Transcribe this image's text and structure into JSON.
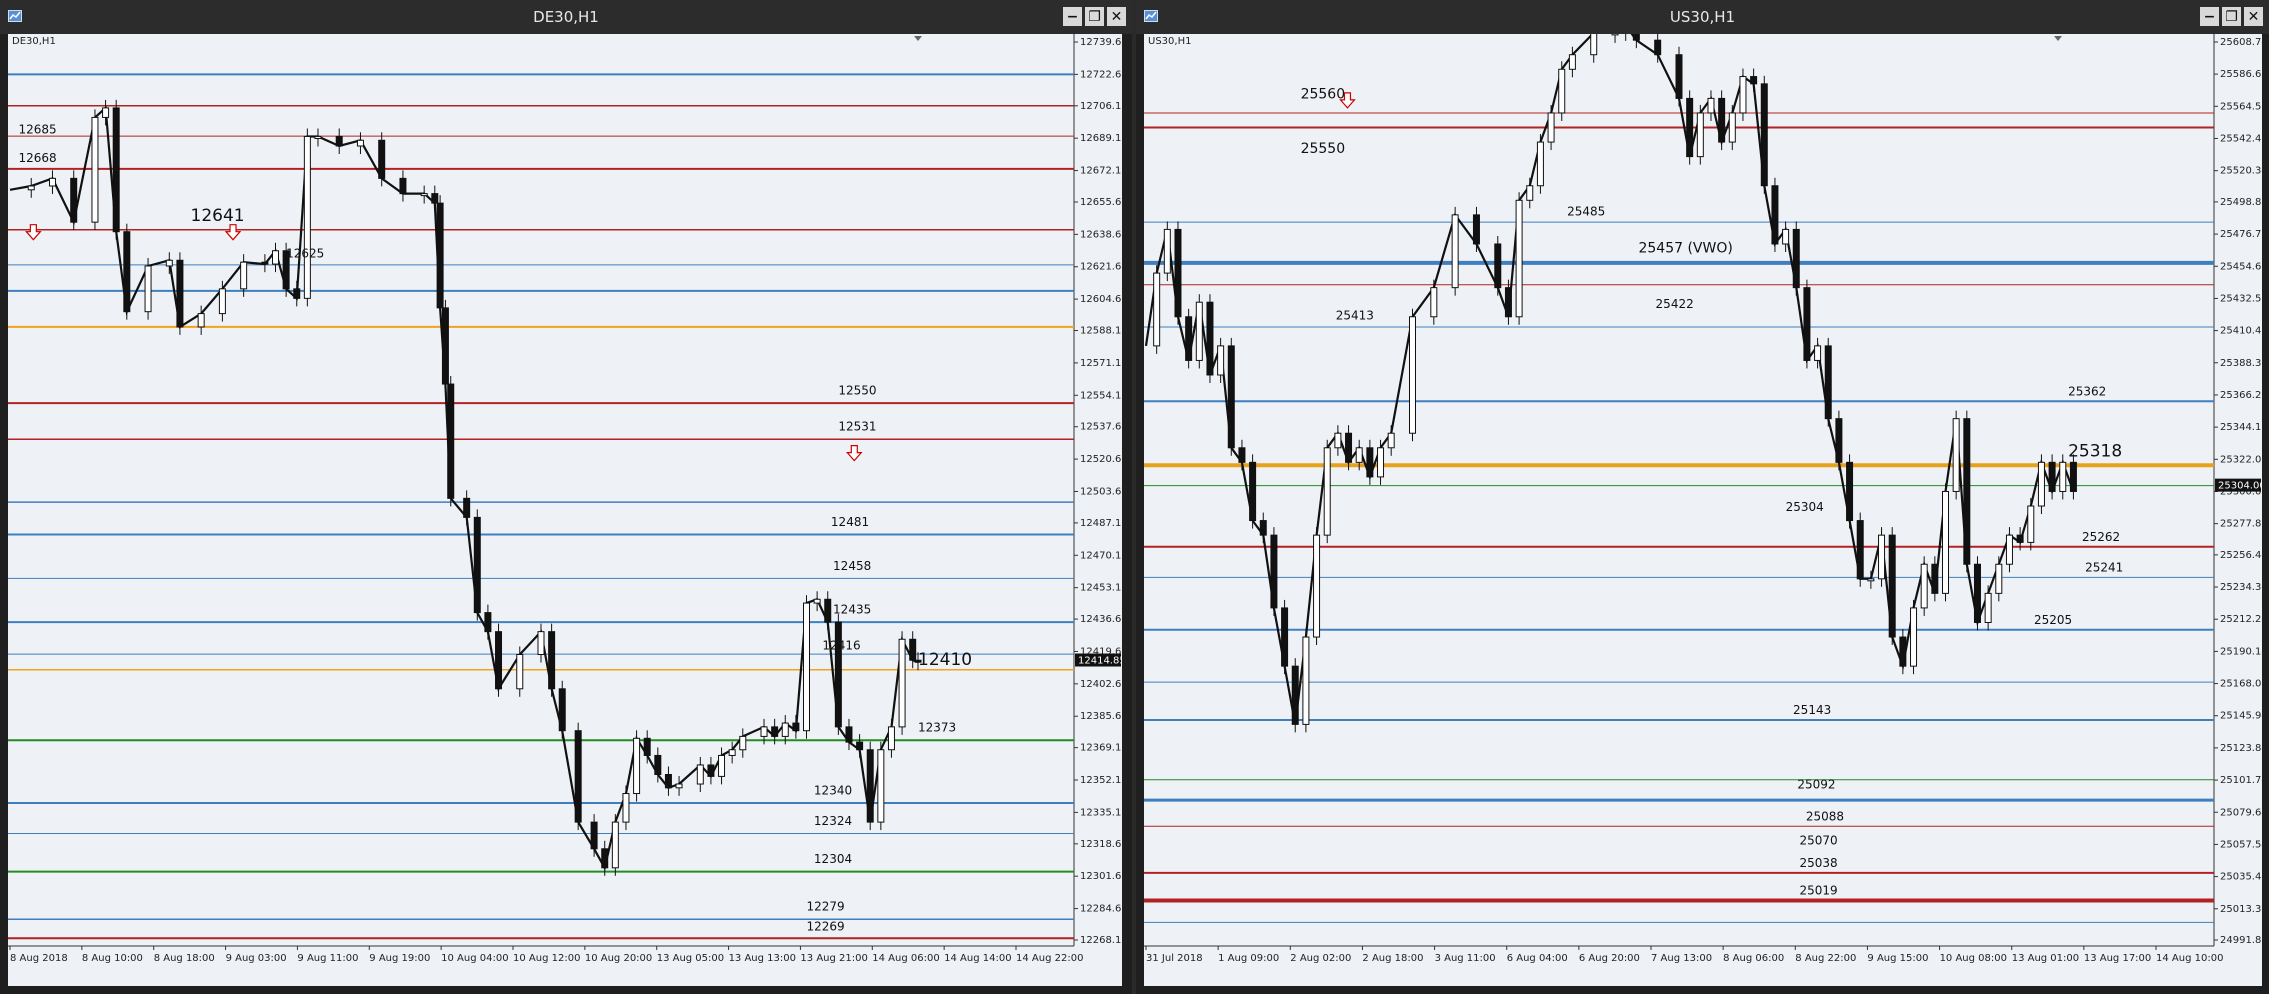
{
  "windows": [
    {
      "id": "de30",
      "title": "DE30,H1",
      "symbol_label": "DE30,H1",
      "current_price": "12414.85",
      "y_range": [
        12268.1,
        12739.6
      ],
      "price_ticks": [
        "12739.60",
        "12722.60",
        "12706.10",
        "12689.10",
        "12672.10",
        "12655.60",
        "12638.60",
        "12621.60",
        "12604.60",
        "12588.10",
        "12571.10",
        "12554.10",
        "12537.60",
        "12520.60",
        "12503.60",
        "12487.10",
        "12470.10",
        "12453.10",
        "12436.60",
        "12419.60",
        "12402.60",
        "12385.60",
        "12369.10",
        "12352.10",
        "12335.10",
        "12318.60",
        "12301.60",
        "12284.60",
        "12268.10"
      ],
      "time_labels": [
        "8 Aug 2018",
        "8 Aug 10:00",
        "8 Aug 18:00",
        "9 Aug 03:00",
        "9 Aug 11:00",
        "9 Aug 19:00",
        "10 Aug 04:00",
        "10 Aug 12:00",
        "10 Aug 20:00",
        "13 Aug 05:00",
        "13 Aug 13:00",
        "13 Aug 21:00",
        "14 Aug 06:00",
        "14 Aug 14:00",
        "14 Aug 22:00"
      ],
      "levels": [
        {
          "price": 12722.6,
          "color": "#3f7fbf",
          "width": 2
        },
        {
          "price": 12706.1,
          "color": "#b22222",
          "width": 1.5
        },
        {
          "price": 12690.2,
          "color": "#b22222",
          "width": 1
        },
        {
          "price": 12673.0,
          "color": "#b22222",
          "width": 2
        },
        {
          "price": 12641.0,
          "color": "#b22222",
          "width": 1.5
        },
        {
          "price": 12622.6,
          "color": "#3f7fbf",
          "width": 1
        },
        {
          "price": 12608.9,
          "color": "#3f7fbf",
          "width": 2
        },
        {
          "price": 12590.0,
          "color": "#f2a31b",
          "width": 2
        },
        {
          "price": 12550.0,
          "color": "#b22222",
          "width": 2
        },
        {
          "price": 12531.0,
          "color": "#b22222",
          "width": 1.5
        },
        {
          "price": 12498.0,
          "color": "#3f7fbf",
          "width": 1.5
        },
        {
          "price": 12481.0,
          "color": "#3f7fbf",
          "width": 2
        },
        {
          "price": 12458.0,
          "color": "#3f7fbf",
          "width": 1
        },
        {
          "price": 12435.0,
          "color": "#3f7fbf",
          "width": 2
        },
        {
          "price": 12418.2,
          "color": "#3f7fbf",
          "width": 1
        },
        {
          "price": 12410.0,
          "color": "#f2a31b",
          "width": 1.5
        },
        {
          "price": 12373.0,
          "color": "#228b22",
          "width": 2
        },
        {
          "price": 12340.0,
          "color": "#3f7fbf",
          "width": 2
        },
        {
          "price": 12324.0,
          "color": "#3f7fbf",
          "width": 1
        },
        {
          "price": 12304.0,
          "color": "#228b22",
          "width": 2
        },
        {
          "price": 12279.0,
          "color": "#3f7fbf",
          "width": 1.5
        },
        {
          "price": 12269.0,
          "color": "#b22222",
          "width": 2
        }
      ],
      "labels": [
        {
          "text": "12685",
          "price": 12691.5,
          "at": 0.008,
          "size": 12
        },
        {
          "text": "12668",
          "price": 12676.5,
          "at": 0.008,
          "size": 12
        },
        {
          "text": "12641",
          "price": 12645.5,
          "at": 0.17,
          "size": 17
        },
        {
          "text": "12625",
          "price": 12626.5,
          "at": 0.26,
          "size": 12
        },
        {
          "text": "12550",
          "price": 12554.5,
          "at": 0.78,
          "size": 12
        },
        {
          "text": "12531",
          "price": 12535.5,
          "at": 0.78,
          "size": 12
        },
        {
          "text": "12481",
          "price": 12485.5,
          "at": 0.773,
          "size": 12
        },
        {
          "text": "12458",
          "price": 12462.5,
          "at": 0.775,
          "size": 12
        },
        {
          "text": "12435",
          "price": 12439.5,
          "at": 0.775,
          "size": 12
        },
        {
          "text": "12416",
          "price": 12420.5,
          "at": 0.765,
          "size": 12
        },
        {
          "text": "12410",
          "price": 12412.5,
          "at": 0.855,
          "size": 17
        },
        {
          "text": "12373",
          "price": 12377.5,
          "at": 0.855,
          "size": 12
        },
        {
          "text": "12340",
          "price": 12344.5,
          "at": 0.757,
          "size": 12
        },
        {
          "text": "12324",
          "price": 12328.5,
          "at": 0.757,
          "size": 12
        },
        {
          "text": "12304",
          "price": 12308.5,
          "at": 0.757,
          "size": 12
        },
        {
          "text": "12279",
          "price": 12283.5,
          "at": 0.75,
          "size": 12
        },
        {
          "text": "12269",
          "price": 12273.0,
          "at": 0.75,
          "size": 12
        }
      ],
      "arrows": [
        {
          "price": 12640.0,
          "at": 0.022
        },
        {
          "price": 12640.0,
          "at": 0.21
        },
        {
          "price": 12524.0,
          "at": 0.795
        }
      ],
      "path": [
        [
          0,
          12662
        ],
        [
          0.02,
          12664
        ],
        [
          0.04,
          12668
        ],
        [
          0.06,
          12645
        ],
        [
          0.08,
          12700
        ],
        [
          0.09,
          12705
        ],
        [
          0.1,
          12640
        ],
        [
          0.11,
          12598
        ],
        [
          0.13,
          12622
        ],
        [
          0.15,
          12625
        ],
        [
          0.16,
          12590
        ],
        [
          0.18,
          12597
        ],
        [
          0.2,
          12610
        ],
        [
          0.22,
          12624
        ],
        [
          0.24,
          12623
        ],
        [
          0.25,
          12630
        ],
        [
          0.26,
          12610
        ],
        [
          0.27,
          12605
        ],
        [
          0.28,
          12690
        ],
        [
          0.29,
          12690
        ],
        [
          0.31,
          12685
        ],
        [
          0.33,
          12688
        ],
        [
          0.35,
          12668
        ],
        [
          0.37,
          12660
        ],
        [
          0.39,
          12660
        ],
        [
          0.4,
          12655
        ],
        [
          0.405,
          12600
        ],
        [
          0.41,
          12560
        ],
        [
          0.415,
          12500
        ],
        [
          0.43,
          12490
        ],
        [
          0.44,
          12440
        ],
        [
          0.45,
          12430
        ],
        [
          0.46,
          12400
        ],
        [
          0.48,
          12418
        ],
        [
          0.5,
          12430
        ],
        [
          0.51,
          12400
        ],
        [
          0.52,
          12378
        ],
        [
          0.535,
          12330
        ],
        [
          0.55,
          12316
        ],
        [
          0.56,
          12306
        ],
        [
          0.57,
          12330
        ],
        [
          0.58,
          12345
        ],
        [
          0.59,
          12374
        ],
        [
          0.6,
          12365
        ],
        [
          0.61,
          12355
        ],
        [
          0.62,
          12348
        ],
        [
          0.63,
          12350
        ],
        [
          0.65,
          12360
        ],
        [
          0.66,
          12354
        ],
        [
          0.67,
          12365
        ],
        [
          0.68,
          12368
        ],
        [
          0.69,
          12375
        ],
        [
          0.71,
          12380
        ],
        [
          0.72,
          12375
        ],
        [
          0.73,
          12382
        ],
        [
          0.74,
          12378
        ],
        [
          0.75,
          12445
        ],
        [
          0.76,
          12447
        ],
        [
          0.77,
          12435
        ],
        [
          0.78,
          12380
        ],
        [
          0.79,
          12372
        ],
        [
          0.8,
          12368
        ],
        [
          0.81,
          12330
        ],
        [
          0.82,
          12368
        ],
        [
          0.83,
          12380
        ],
        [
          0.84,
          12426
        ],
        [
          0.85,
          12415
        ],
        [
          0.855,
          12414
        ]
      ]
    },
    {
      "id": "us30",
      "title": "US30,H1",
      "symbol_label": "US30,H1",
      "current_price": "25304.00",
      "y_range": [
        24991.89,
        25608.74
      ],
      "price_ticks": [
        "25608.74",
        "25586.69",
        "25564.59",
        "25542.49",
        "25520.34",
        "25498.89",
        "25476.79",
        "25454.69",
        "25432.59",
        "25410.49",
        "25388.39",
        "25366.29",
        "25344.19",
        "25322.09",
        "25300.00",
        "25277.89",
        "25256.44",
        "25234.34",
        "25212.24",
        "25190.14",
        "25168.04",
        "25145.94",
        "25123.84",
        "25101.74",
        "25079.64",
        "25057.54",
        "25035.44",
        "25013.34",
        "24991.89"
      ],
      "time_labels": [
        "31 Jul 2018",
        "1 Aug 09:00",
        "2 Aug 02:00",
        "2 Aug 18:00",
        "3 Aug 11:00",
        "6 Aug 04:00",
        "6 Aug 20:00",
        "7 Aug 13:00",
        "8 Aug 06:00",
        "8 Aug 22:00",
        "9 Aug 15:00",
        "10 Aug 08:00",
        "13 Aug 01:00",
        "13 Aug 17:00",
        "14 Aug 10:00"
      ],
      "levels": [
        {
          "price": 25560.0,
          "color": "#b22222",
          "width": 1
        },
        {
          "price": 25550.0,
          "color": "#b22222",
          "width": 2
        },
        {
          "price": 25485.0,
          "color": "#3f7fbf",
          "width": 1
        },
        {
          "price": 25457.0,
          "color": "#3f7fbf",
          "width": 4
        },
        {
          "price": 25442.0,
          "color": "#b22222",
          "width": 1
        },
        {
          "price": 25413.0,
          "color": "#3f7fbf",
          "width": 1
        },
        {
          "price": 25362.0,
          "color": "#3f7fbf",
          "width": 2
        },
        {
          "price": 25318.0,
          "color": "#e6a21b",
          "width": 4
        },
        {
          "price": 25304.0,
          "color": "#228b22",
          "width": 1
        },
        {
          "price": 25262.0,
          "color": "#b22222",
          "width": 2
        },
        {
          "price": 25241.0,
          "color": "#3f7fbf",
          "width": 1
        },
        {
          "price": 25205.0,
          "color": "#3f7fbf",
          "width": 2
        },
        {
          "price": 25169.0,
          "color": "#3f7fbf",
          "width": 1
        },
        {
          "price": 25143.0,
          "color": "#3f7fbf",
          "width": 2
        },
        {
          "price": 25102.0,
          "color": "#228b22",
          "width": 1
        },
        {
          "price": 25088.0,
          "color": "#3f7fbf",
          "width": 3
        },
        {
          "price": 25070.0,
          "color": "#b22222",
          "width": 1
        },
        {
          "price": 25038.0,
          "color": "#b22222",
          "width": 2
        },
        {
          "price": 25019.0,
          "color": "#b22222",
          "width": 4
        },
        {
          "price": 25004.0,
          "color": "#3f7fbf",
          "width": 1
        }
      ],
      "labels": [
        {
          "text": "25560",
          "price": 25570.0,
          "at": 0.145,
          "size": 14
        },
        {
          "text": "25550",
          "price": 25532.5,
          "at": 0.145,
          "size": 14
        },
        {
          "text": "25485",
          "price": 25489.5,
          "at": 0.395,
          "size": 12
        },
        {
          "text": "25457 (VWO)",
          "price": 25464.0,
          "at": 0.462,
          "size": 14
        },
        {
          "text": "25422",
          "price": 25426.0,
          "at": 0.478,
          "size": 12
        },
        {
          "text": "25413",
          "price": 25418.0,
          "at": 0.178,
          "size": 12
        },
        {
          "text": "25362",
          "price": 25366.0,
          "at": 0.865,
          "size": 12
        },
        {
          "text": "25318",
          "price": 25324.0,
          "at": 0.865,
          "size": 17
        },
        {
          "text": "25304",
          "price": 25286.5,
          "at": 0.6,
          "size": 12
        },
        {
          "text": "25262",
          "price": 25266.0,
          "at": 0.878,
          "size": 12
        },
        {
          "text": "25241",
          "price": 25245.0,
          "at": 0.881,
          "size": 12
        },
        {
          "text": "25205",
          "price": 25209.0,
          "at": 0.833,
          "size": 12
        },
        {
          "text": "25143",
          "price": 25147.0,
          "at": 0.607,
          "size": 12
        },
        {
          "text": "25092",
          "price": 25096.0,
          "at": 0.611,
          "size": 12
        },
        {
          "text": "25088",
          "price": 25074.0,
          "at": 0.619,
          "size": 12
        },
        {
          "text": "25070",
          "price": 25057.5,
          "at": 0.613,
          "size": 12
        },
        {
          "text": "25038",
          "price": 25042.0,
          "at": 0.613,
          "size": 12
        },
        {
          "text": "25019",
          "price": 25023.0,
          "at": 0.613,
          "size": 12
        }
      ],
      "arrows": [
        {
          "price": 25569.0,
          "at": 0.189
        }
      ],
      "path": [
        [
          0,
          25400
        ],
        [
          0.01,
          25450
        ],
        [
          0.02,
          25480
        ],
        [
          0.03,
          25420
        ],
        [
          0.04,
          25390
        ],
        [
          0.05,
          25430
        ],
        [
          0.06,
          25380
        ],
        [
          0.07,
          25400
        ],
        [
          0.08,
          25330
        ],
        [
          0.09,
          25320
        ],
        [
          0.1,
          25280
        ],
        [
          0.11,
          25270
        ],
        [
          0.12,
          25220
        ],
        [
          0.13,
          25180
        ],
        [
          0.14,
          25140
        ],
        [
          0.15,
          25200
        ],
        [
          0.16,
          25270
        ],
        [
          0.17,
          25330
        ],
        [
          0.18,
          25340
        ],
        [
          0.19,
          25320
        ],
        [
          0.2,
          25330
        ],
        [
          0.21,
          25310
        ],
        [
          0.22,
          25330
        ],
        [
          0.23,
          25340
        ],
        [
          0.25,
          25420
        ],
        [
          0.27,
          25440
        ],
        [
          0.29,
          25490
        ],
        [
          0.31,
          25470
        ],
        [
          0.33,
          25440
        ],
        [
          0.34,
          25420
        ],
        [
          0.35,
          25500
        ],
        [
          0.36,
          25510
        ],
        [
          0.37,
          25540
        ],
        [
          0.38,
          25560
        ],
        [
          0.39,
          25590
        ],
        [
          0.4,
          25600
        ],
        [
          0.42,
          25615
        ],
        [
          0.44,
          25615
        ],
        [
          0.45,
          25620
        ],
        [
          0.46,
          25610
        ],
        [
          0.48,
          25600
        ],
        [
          0.5,
          25570
        ],
        [
          0.51,
          25530
        ],
        [
          0.52,
          25560
        ],
        [
          0.53,
          25570
        ],
        [
          0.54,
          25540
        ],
        [
          0.55,
          25560
        ],
        [
          0.56,
          25585
        ],
        [
          0.57,
          25580
        ],
        [
          0.58,
          25510
        ],
        [
          0.59,
          25470
        ],
        [
          0.6,
          25480
        ],
        [
          0.61,
          25440
        ],
        [
          0.62,
          25390
        ],
        [
          0.63,
          25400
        ],
        [
          0.64,
          25350
        ],
        [
          0.65,
          25320
        ],
        [
          0.66,
          25280
        ],
        [
          0.67,
          25240
        ],
        [
          0.68,
          25240
        ],
        [
          0.69,
          25270
        ],
        [
          0.7,
          25200
        ],
        [
          0.71,
          25180
        ],
        [
          0.72,
          25220
        ],
        [
          0.73,
          25250
        ],
        [
          0.74,
          25230
        ],
        [
          0.75,
          25300
        ],
        [
          0.76,
          25350
        ],
        [
          0.77,
          25250
        ],
        [
          0.78,
          25210
        ],
        [
          0.79,
          25230
        ],
        [
          0.8,
          25250
        ],
        [
          0.81,
          25270
        ],
        [
          0.82,
          25265
        ],
        [
          0.83,
          25290
        ],
        [
          0.84,
          25320
        ],
        [
          0.85,
          25300
        ],
        [
          0.86,
          25320
        ],
        [
          0.87,
          25300
        ]
      ]
    }
  ]
}
